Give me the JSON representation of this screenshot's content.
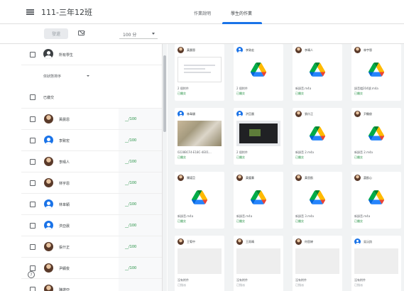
{
  "header": {
    "class_name": "111-三年12班",
    "tabs": [
      "作業說明",
      "學生的作業"
    ]
  },
  "toolbar": {
    "return_label": "發還",
    "points_value": "100 分"
  },
  "student_panel": {
    "all_students_label": "所有學生",
    "sort_label": "依狀態排序",
    "submitted_group_label": "已繳交",
    "students": [
      {
        "name": "黃晨恩",
        "grade": "__/100",
        "avatar": "photo"
      },
      {
        "name": "李致宏",
        "grade": "__/100",
        "avatar": "blue"
      },
      {
        "name": "李晴人",
        "grade": "__/100",
        "avatar": "photo"
      },
      {
        "name": "林宇恩",
        "grade": "__/100",
        "avatar": "photo"
      },
      {
        "name": "林韋穎",
        "grade": "__/100",
        "avatar": "blue"
      },
      {
        "name": "洪亞晨",
        "grade": "__/100",
        "avatar": "blue"
      },
      {
        "name": "張什正",
        "grade": "__/100",
        "avatar": "photo"
      },
      {
        "name": "尹顯俊",
        "grade": "__/100",
        "avatar": "photo"
      },
      {
        "name": "陳諾亞",
        "grade": "",
        "avatar": "photo"
      }
    ]
  },
  "submissions": [
    {
      "name": "黃晨恩",
      "avatar": "photo",
      "thumb": "doc",
      "file": "2 個附件",
      "status": "已繳交"
    },
    {
      "name": "李致宏",
      "avatar": "blue",
      "thumb": "drive",
      "file": "2 個附件",
      "status": "已繳交"
    },
    {
      "name": "李晴人",
      "avatar": "photo",
      "thumb": "drive",
      "file": "新錄音.m4a",
      "status": "已繳交"
    },
    {
      "name": "林宇恩",
      "avatar": "photo",
      "thumb": "drive",
      "file": "錄音檔204號.m4a",
      "status": "已繳交"
    },
    {
      "name": "林韋穎",
      "avatar": "blue",
      "thumb": "photo1",
      "file": "0228BCF4-E18C-4E01...",
      "status": "已繳交"
    },
    {
      "name": "洪亞晨",
      "avatar": "blue",
      "thumb": "dark",
      "file": "2 個附件",
      "status": "已繳交"
    },
    {
      "name": "張什正",
      "avatar": "photo",
      "thumb": "drive",
      "file": "新錄音 2.m4a",
      "status": "已繳交"
    },
    {
      "name": "尹顯俊",
      "avatar": "photo",
      "thumb": "drive",
      "file": "新錄音 2.m4a",
      "status": "已繳交"
    },
    {
      "name": "陳諾亞",
      "avatar": "photo",
      "thumb": "drive",
      "file": "新錄音.m4a",
      "status": "已繳交"
    },
    {
      "name": "黃璧蓁",
      "avatar": "photo",
      "thumb": "drive",
      "file": "新錄音.m4a",
      "status": "已繳交"
    },
    {
      "name": "黃思凱",
      "avatar": "photo",
      "thumb": "drive",
      "file": "新錄音 3.m4a",
      "status": "已繳交"
    },
    {
      "name": "蕭凱心",
      "avatar": "photo",
      "thumb": "drive",
      "file": "新錄音.m4a",
      "status": "已繳交"
    },
    {
      "name": "王宥中",
      "avatar": "photo",
      "thumb": "plain",
      "file": "沒有附件",
      "status": "已指派"
    },
    {
      "name": "王雨晴",
      "avatar": "photo",
      "thumb": "plain",
      "file": "沒有附件",
      "status": "已指派"
    },
    {
      "name": "何思婷",
      "avatar": "photo",
      "thumb": "plain",
      "file": "沒有附件",
      "status": "已指派"
    },
    {
      "name": "吳沅鈞",
      "avatar": "blue",
      "thumb": "plain",
      "file": "沒有附件",
      "status": "已指派"
    }
  ],
  "icons": {
    "menu": "hamburger-icon",
    "mail": "mail-icon",
    "help": "help-icon",
    "drive": "google-drive-icon"
  },
  "colors": {
    "accent": "#1a73e8",
    "grade_green": "#1e8e3e",
    "grid_background": "#f1f3f4"
  }
}
